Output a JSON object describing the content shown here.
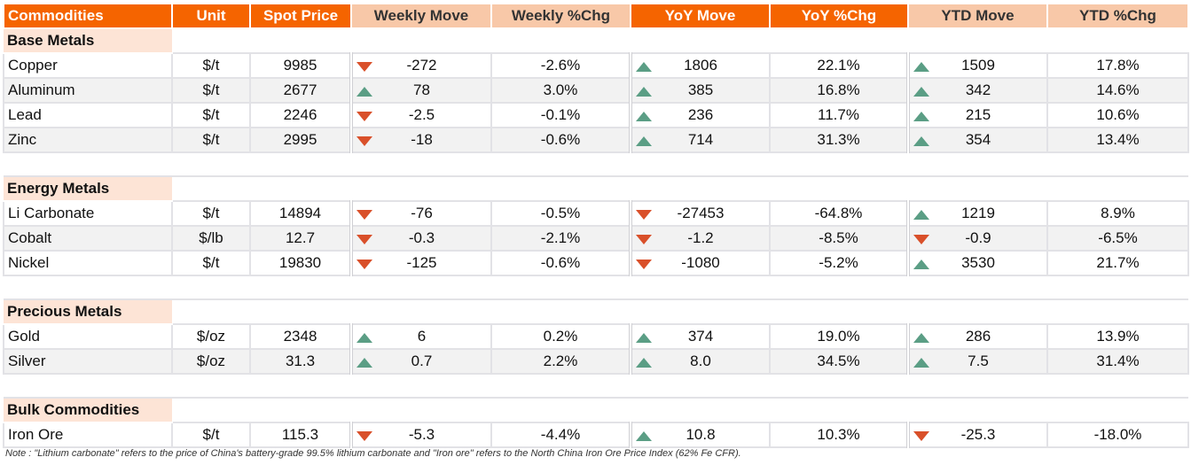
{
  "headers": [
    "Commodities",
    "Unit",
    "Spot Price",
    "Weekly Move",
    "Weekly %Chg",
    "YoY Move",
    "YoY  %Chg",
    "YTD Move",
    "YTD %Chg"
  ],
  "colors": {
    "header_orange": "#f56400",
    "header_peach": "#f8c8a8",
    "section": "#fde4d6",
    "up": "#5b9e85",
    "down": "#d9502a"
  },
  "sections": [
    {
      "title": "Base Metals",
      "rows": [
        {
          "name": "Copper",
          "unit": "$/t",
          "spot": "9985",
          "wm": "-272",
          "wm_dir": "down",
          "wp": "-2.6%",
          "ym": "1806",
          "ym_dir": "up",
          "yp": "22.1%",
          "tm": "1509",
          "tm_dir": "up",
          "tp": "17.8%"
        },
        {
          "name": "Aluminum",
          "unit": "$/t",
          "spot": "2677",
          "wm": "78",
          "wm_dir": "up",
          "wp": "3.0%",
          "ym": "385",
          "ym_dir": "up",
          "yp": "16.8%",
          "tm": "342",
          "tm_dir": "up",
          "tp": "14.6%"
        },
        {
          "name": "Lead",
          "unit": "$/t",
          "spot": "2246",
          "wm": "-2.5",
          "wm_dir": "down",
          "wp": "-0.1%",
          "ym": "236",
          "ym_dir": "up",
          "yp": "11.7%",
          "tm": "215",
          "tm_dir": "up",
          "tp": "10.6%"
        },
        {
          "name": "Zinc",
          "unit": "$/t",
          "spot": "2995",
          "wm": "-18",
          "wm_dir": "down",
          "wp": "-0.6%",
          "ym": "714",
          "ym_dir": "up",
          "yp": "31.3%",
          "tm": "354",
          "tm_dir": "up",
          "tp": "13.4%"
        }
      ]
    },
    {
      "title": "Energy Metals",
      "rows": [
        {
          "name": "Li Carbonate",
          "unit": "$/t",
          "spot": "14894",
          "wm": "-76",
          "wm_dir": "down",
          "wp": "-0.5%",
          "ym": "-27453",
          "ym_dir": "down",
          "yp": "-64.8%",
          "tm": "1219",
          "tm_dir": "up",
          "tp": "8.9%"
        },
        {
          "name": "Cobalt",
          "unit": "$/lb",
          "spot": "12.7",
          "wm": "-0.3",
          "wm_dir": "down",
          "wp": "-2.1%",
          "ym": "-1.2",
          "ym_dir": "down",
          "yp": "-8.5%",
          "tm": "-0.9",
          "tm_dir": "down",
          "tp": "-6.5%"
        },
        {
          "name": "Nickel",
          "unit": "$/t",
          "spot": "19830",
          "wm": "-125",
          "wm_dir": "down",
          "wp": "-0.6%",
          "ym": "-1080",
          "ym_dir": "down",
          "yp": "-5.2%",
          "tm": "3530",
          "tm_dir": "up",
          "tp": "21.7%"
        }
      ]
    },
    {
      "title": "Precious Metals",
      "rows": [
        {
          "name": "Gold",
          "unit": "$/oz",
          "spot": "2348",
          "wm": "6",
          "wm_dir": "up",
          "wp": "0.2%",
          "ym": "374",
          "ym_dir": "up",
          "yp": "19.0%",
          "tm": "286",
          "tm_dir": "up",
          "tp": "13.9%"
        },
        {
          "name": "Silver",
          "unit": "$/oz",
          "spot": "31.3",
          "wm": "0.7",
          "wm_dir": "up",
          "wp": "2.2%",
          "ym": "8.0",
          "ym_dir": "up",
          "yp": "34.5%",
          "tm": "7.5",
          "tm_dir": "up",
          "tp": "31.4%"
        }
      ]
    },
    {
      "title": "Bulk Commodities",
      "rows": [
        {
          "name": "Iron Ore",
          "unit": "$/t",
          "spot": "115.3",
          "wm": "-5.3",
          "wm_dir": "down",
          "wp": "-4.4%",
          "ym": "10.8",
          "ym_dir": "up",
          "yp": "10.3%",
          "tm": "-25.3",
          "tm_dir": "down",
          "tp": "-18.0%"
        }
      ]
    }
  ],
  "note": "Note :  \"Lithium carbonate\" refers to the price of China's battery-grade 99.5% lithium carbonate and \"Iron ore\" refers to the North China Iron Ore Price Index (62% Fe CFR)."
}
